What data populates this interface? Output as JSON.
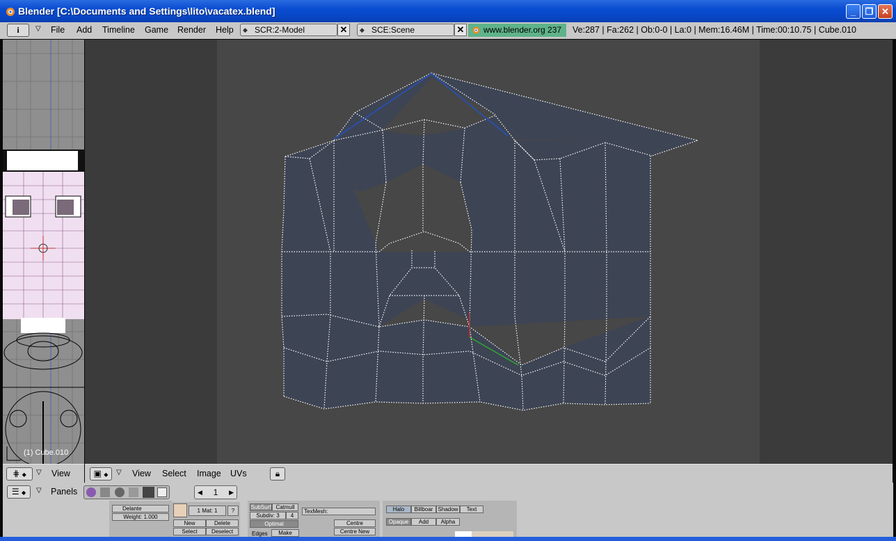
{
  "window": {
    "title": "Blender [C:\\Documents and Settings\\lito\\vacatex.blend]",
    "minimize": "_",
    "maximize": "❐",
    "close": "✕"
  },
  "topbar": {
    "info_icon": "i",
    "menus": [
      "File",
      "Add",
      "Timeline",
      "Game",
      "Render",
      "Help"
    ],
    "screen_field": "SCR:2-Model",
    "scene_field": "SCE:Scene",
    "url": "www.blender.org 237",
    "stats": "Ve:287 | Fa:262 | Ob:0-0 | La:0 | Mem:16.46M | Time:00:10.75 | Cube.010"
  },
  "left_view": {
    "object_label": "(1) Cube.010",
    "header_view": "View"
  },
  "uv_header": {
    "menus": [
      "View",
      "Select",
      "Image",
      "UVs"
    ]
  },
  "buttons_header": {
    "panels_label": "Panels",
    "frame_value": "1"
  },
  "buttons": {
    "vertex_group": "Delante",
    "weight": "Weight: 1.000",
    "mat": "1 Mat: 1",
    "question": "?",
    "new": "New",
    "delete": "Delete",
    "select": "Select",
    "deselect": "Deselect",
    "subsurf": "SubSurf",
    "catmull": "Catmull",
    "subdiv": "Subdiv: 3",
    "subdiv_r": "4",
    "optimal": "Optimal",
    "texmesh": "TexMesh:",
    "centre": "Centre",
    "centre_new": "Centre New",
    "edges": "Edges",
    "make": "Make",
    "halo": "Halo",
    "billboard": "Billboar",
    "shadow": "Shadow",
    "text": "Text",
    "opaque": "Opaque",
    "add": "Add",
    "alpha": "Alpha"
  },
  "colors": {
    "titlebar": "#0a4cd1",
    "ui_gray": "#c8c8c8",
    "mesh_face": "#3d4454",
    "url_green": "#5fb38a"
  }
}
